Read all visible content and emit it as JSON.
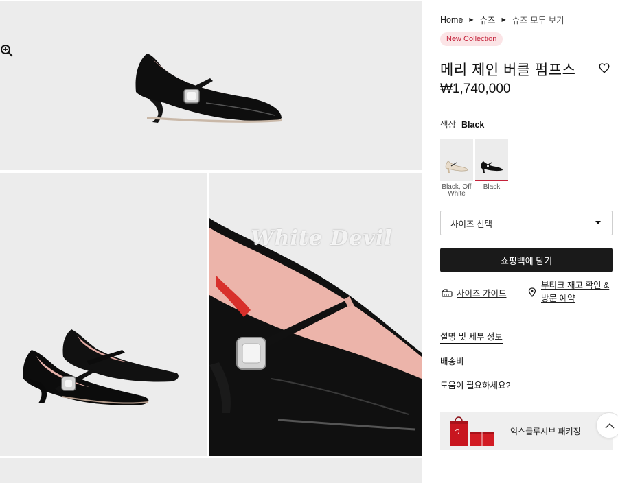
{
  "breadcrumb": [
    {
      "label": "Home"
    },
    {
      "label": "슈즈"
    },
    {
      "label": "슈즈 모두 보기"
    }
  ],
  "product": {
    "badge": "New Collection",
    "title": "메리 제인 버클 펌프스",
    "price": "₩1,740,000"
  },
  "color": {
    "label": "색상",
    "selected": "Black",
    "options": [
      {
        "caption": "Black, Off White"
      },
      {
        "caption": "Black"
      }
    ]
  },
  "size_select": {
    "placeholder": "사이즈 선택"
  },
  "actions": {
    "add_to_bag": "쇼핑백에 담기",
    "size_guide": "사이즈 가이드",
    "boutique": "부티크 재고 확인 & 방문 예약"
  },
  "links": {
    "description": "설명 및 세부 정보",
    "shipping": "배송비",
    "help": "도움이 필요하세요?"
  },
  "promo": {
    "label": "익스클루시브 패키징"
  },
  "watermark": "White Devil",
  "icons": {
    "zoom": "zoom-in-icon",
    "wishlist": "heart-icon",
    "size_guide": "ruler-icon",
    "boutique": "location-pin-icon",
    "scroll_top": "chevron-up-icon"
  },
  "colors": {
    "badge_bg": "#fbe4e6",
    "badge_text": "#c4223a",
    "button_bg": "#1a1a1a",
    "tile_bg": "#ececec"
  }
}
